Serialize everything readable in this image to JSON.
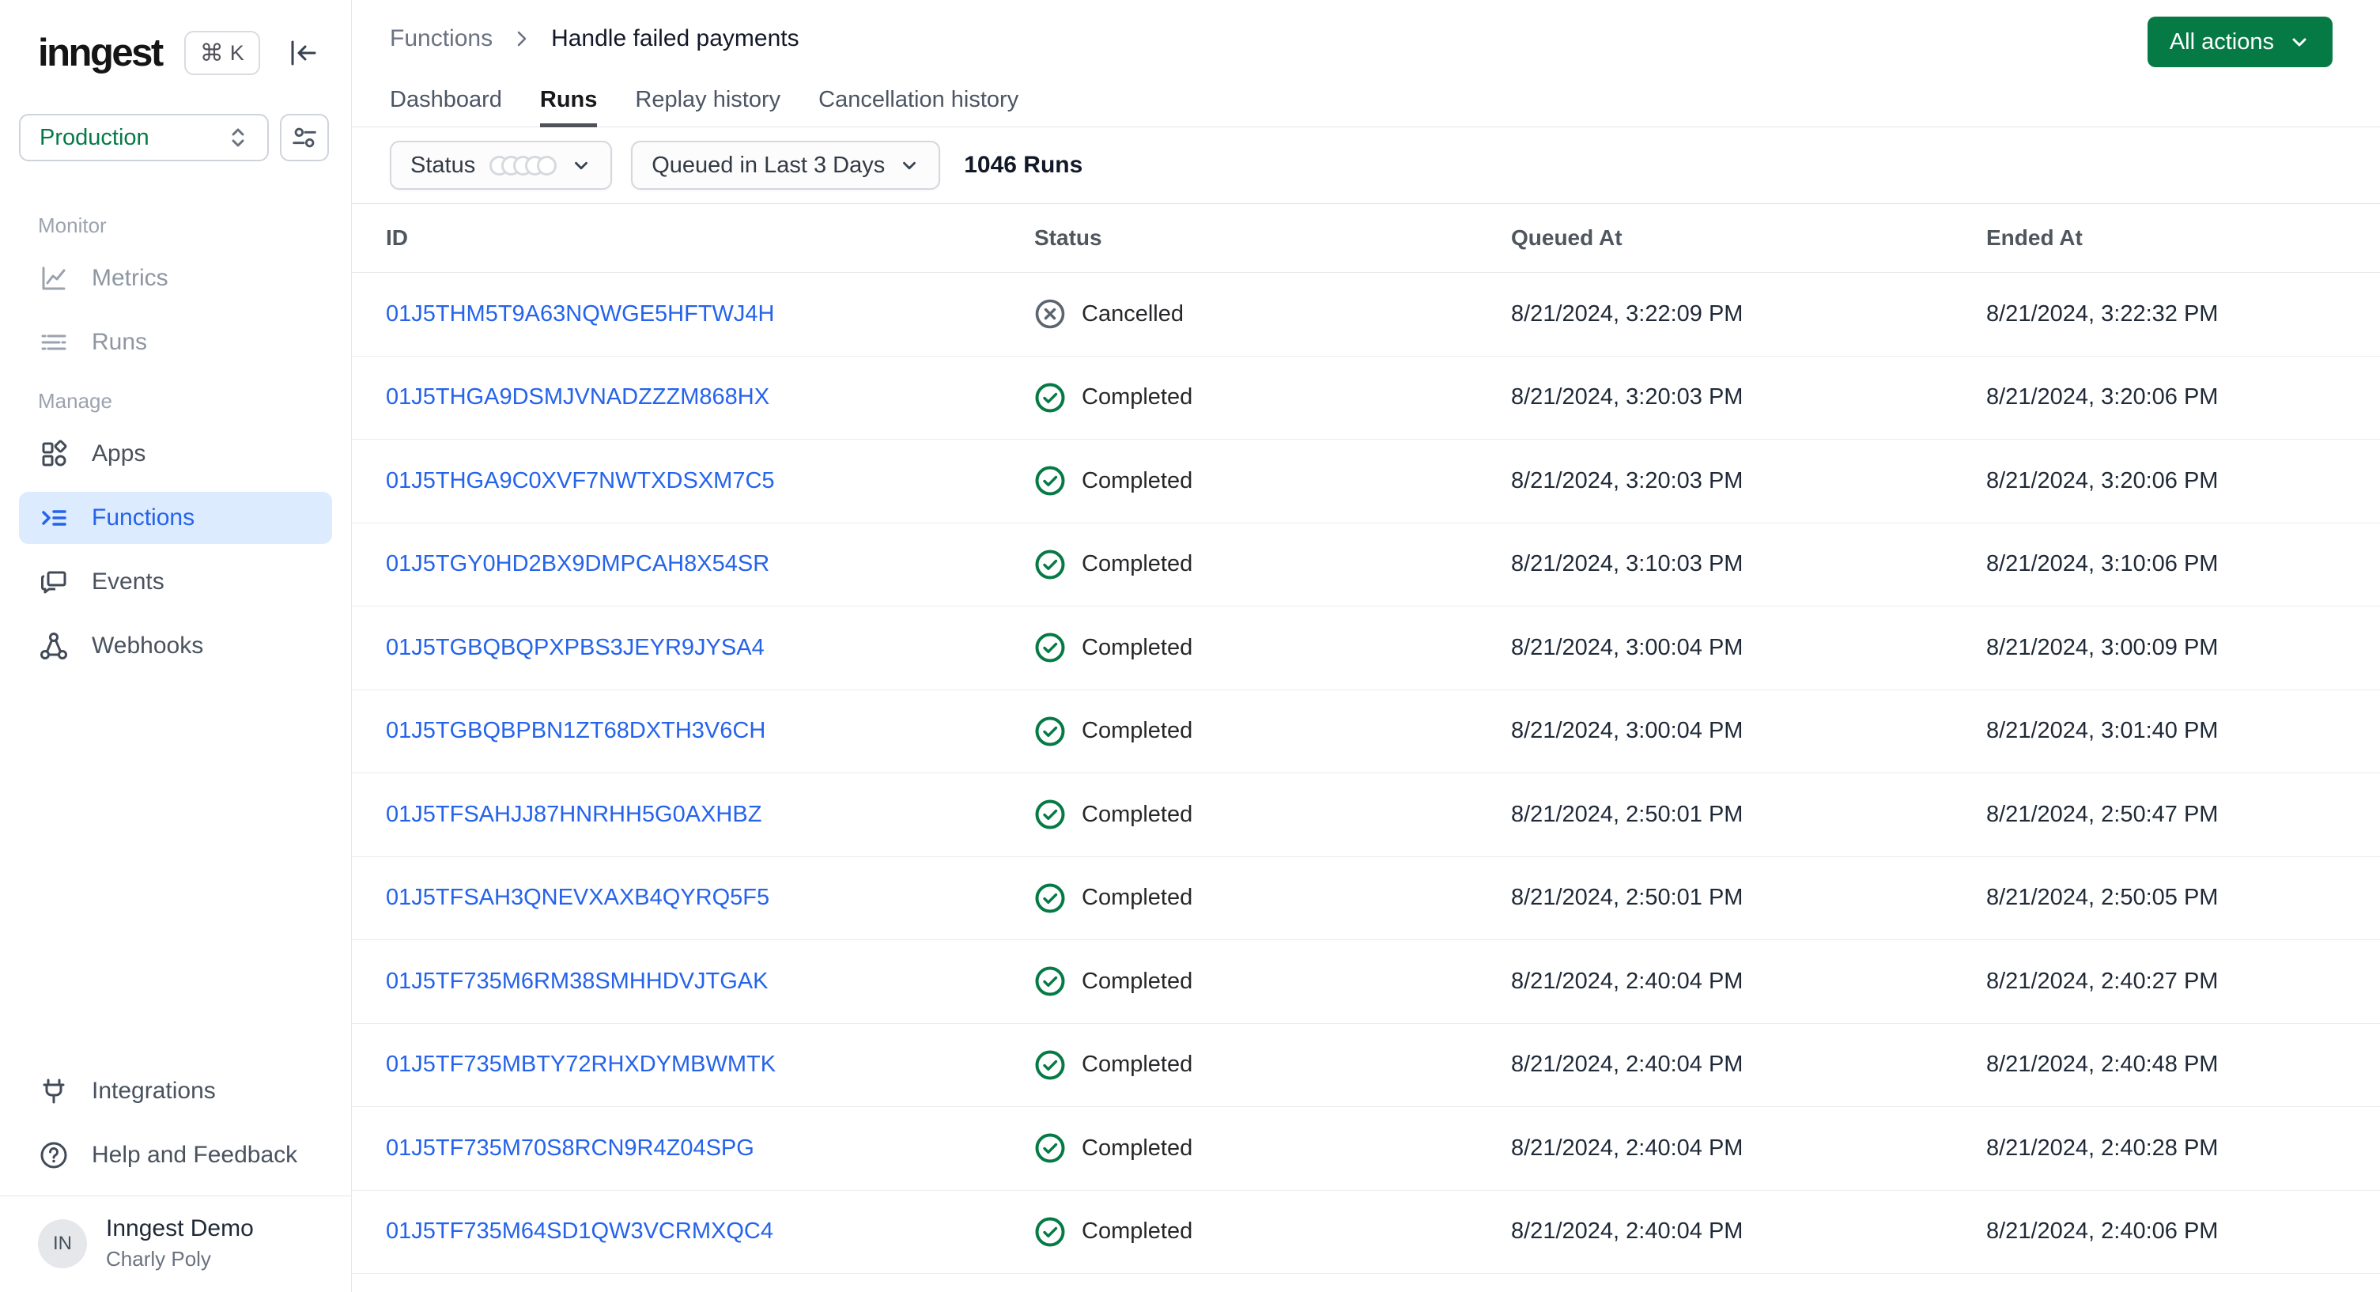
{
  "colors": {
    "accent_green": "#067a45",
    "link_blue": "#2563eb",
    "active_nav_bg": "#dcebfd",
    "completed_green": "#067a45",
    "cancelled_gray": "#5b6470"
  },
  "sidebar": {
    "logo": "inngest",
    "shortcut_cmd": "⌘",
    "shortcut_key": "K",
    "workspace": "Production",
    "sections": [
      {
        "label": "Monitor",
        "items": [
          {
            "label": "Metrics",
            "icon": "chart-icon"
          },
          {
            "label": "Runs",
            "icon": "list-icon"
          }
        ]
      },
      {
        "label": "Manage",
        "items": [
          {
            "label": "Apps",
            "icon": "apps-icon"
          },
          {
            "label": "Functions",
            "icon": "functions-icon",
            "active": true
          },
          {
            "label": "Events",
            "icon": "events-icon"
          },
          {
            "label": "Webhooks",
            "icon": "webhooks-icon"
          }
        ]
      }
    ],
    "footer_items": [
      {
        "label": "Integrations",
        "icon": "plug-icon"
      },
      {
        "label": "Help and Feedback",
        "icon": "help-icon"
      }
    ],
    "user": {
      "initials": "IN",
      "org": "Inngest Demo",
      "name": "Charly Poly"
    }
  },
  "header": {
    "breadcrumb": [
      "Functions",
      "Handle failed payments"
    ],
    "tabs": [
      {
        "label": "Dashboard",
        "active": false
      },
      {
        "label": "Runs",
        "active": true
      },
      {
        "label": "Replay history",
        "active": false
      },
      {
        "label": "Cancellation history",
        "active": false
      }
    ],
    "actions_button": "All actions"
  },
  "filters": {
    "status_label": "Status",
    "range_label": "Queued in Last 3 Days",
    "runs_count": "1046 Runs"
  },
  "table": {
    "columns": [
      "ID",
      "Status",
      "Queued At",
      "Ended At"
    ],
    "rows": [
      {
        "id": "01J5THM5T9A63NQWGE5HFTWJ4H",
        "status": "Cancelled",
        "queued_at": "8/21/2024, 3:22:09 PM",
        "ended_at": "8/21/2024, 3:22:32 PM"
      },
      {
        "id": "01J5THGA9DSMJVNADZZZM868HX",
        "status": "Completed",
        "queued_at": "8/21/2024, 3:20:03 PM",
        "ended_at": "8/21/2024, 3:20:06 PM"
      },
      {
        "id": "01J5THGA9C0XVF7NWTXDSXM7C5",
        "status": "Completed",
        "queued_at": "8/21/2024, 3:20:03 PM",
        "ended_at": "8/21/2024, 3:20:06 PM"
      },
      {
        "id": "01J5TGY0HD2BX9DMPCAH8X54SR",
        "status": "Completed",
        "queued_at": "8/21/2024, 3:10:03 PM",
        "ended_at": "8/21/2024, 3:10:06 PM"
      },
      {
        "id": "01J5TGBQBQPXPBS3JEYR9JYSA4",
        "status": "Completed",
        "queued_at": "8/21/2024, 3:00:04 PM",
        "ended_at": "8/21/2024, 3:00:09 PM"
      },
      {
        "id": "01J5TGBQBPBN1ZT68DXTH3V6CH",
        "status": "Completed",
        "queued_at": "8/21/2024, 3:00:04 PM",
        "ended_at": "8/21/2024, 3:01:40 PM"
      },
      {
        "id": "01J5TFSAHJJ87HNRHH5G0AXHBZ",
        "status": "Completed",
        "queued_at": "8/21/2024, 2:50:01 PM",
        "ended_at": "8/21/2024, 2:50:47 PM"
      },
      {
        "id": "01J5TFSAH3QNEVXAXB4QYRQ5F5",
        "status": "Completed",
        "queued_at": "8/21/2024, 2:50:01 PM",
        "ended_at": "8/21/2024, 2:50:05 PM"
      },
      {
        "id": "01J5TF735M6RM38SMHHDVJTGAK",
        "status": "Completed",
        "queued_at": "8/21/2024, 2:40:04 PM",
        "ended_at": "8/21/2024, 2:40:27 PM"
      },
      {
        "id": "01J5TF735MBTY72RHXDYMBWMTK",
        "status": "Completed",
        "queued_at": "8/21/2024, 2:40:04 PM",
        "ended_at": "8/21/2024, 2:40:48 PM"
      },
      {
        "id": "01J5TF735M70S8RCN9R4Z04SPG",
        "status": "Completed",
        "queued_at": "8/21/2024, 2:40:04 PM",
        "ended_at": "8/21/2024, 2:40:28 PM"
      },
      {
        "id": "01J5TF735M64SD1QW3VCRMXQC4",
        "status": "Completed",
        "queued_at": "8/21/2024, 2:40:04 PM",
        "ended_at": "8/21/2024, 2:40:06 PM"
      }
    ]
  }
}
